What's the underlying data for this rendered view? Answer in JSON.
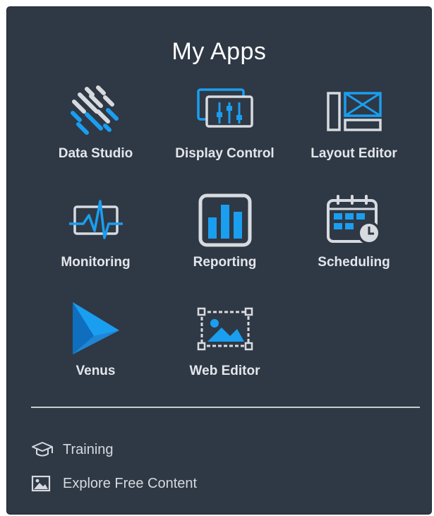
{
  "panel": {
    "title": "My Apps"
  },
  "apps": [
    {
      "label": "Data Studio",
      "icon": "data-studio-icon"
    },
    {
      "label": "Display Control",
      "icon": "display-control-icon"
    },
    {
      "label": "Layout Editor",
      "icon": "layout-editor-icon"
    },
    {
      "label": "Monitoring",
      "icon": "monitoring-icon"
    },
    {
      "label": "Reporting",
      "icon": "reporting-icon"
    },
    {
      "label": "Scheduling",
      "icon": "scheduling-icon"
    },
    {
      "label": "Venus",
      "icon": "venus-icon"
    },
    {
      "label": "Web Editor",
      "icon": "web-editor-icon"
    }
  ],
  "links": [
    {
      "label": "Training",
      "icon": "graduation-cap-icon"
    },
    {
      "label": "Explore Free Content",
      "icon": "image-icon"
    }
  ],
  "colors": {
    "background": "#2f3845",
    "accent_blue": "#1a9ef0",
    "icon_gray": "#d7dbe0",
    "text": "#e3e6ea"
  }
}
